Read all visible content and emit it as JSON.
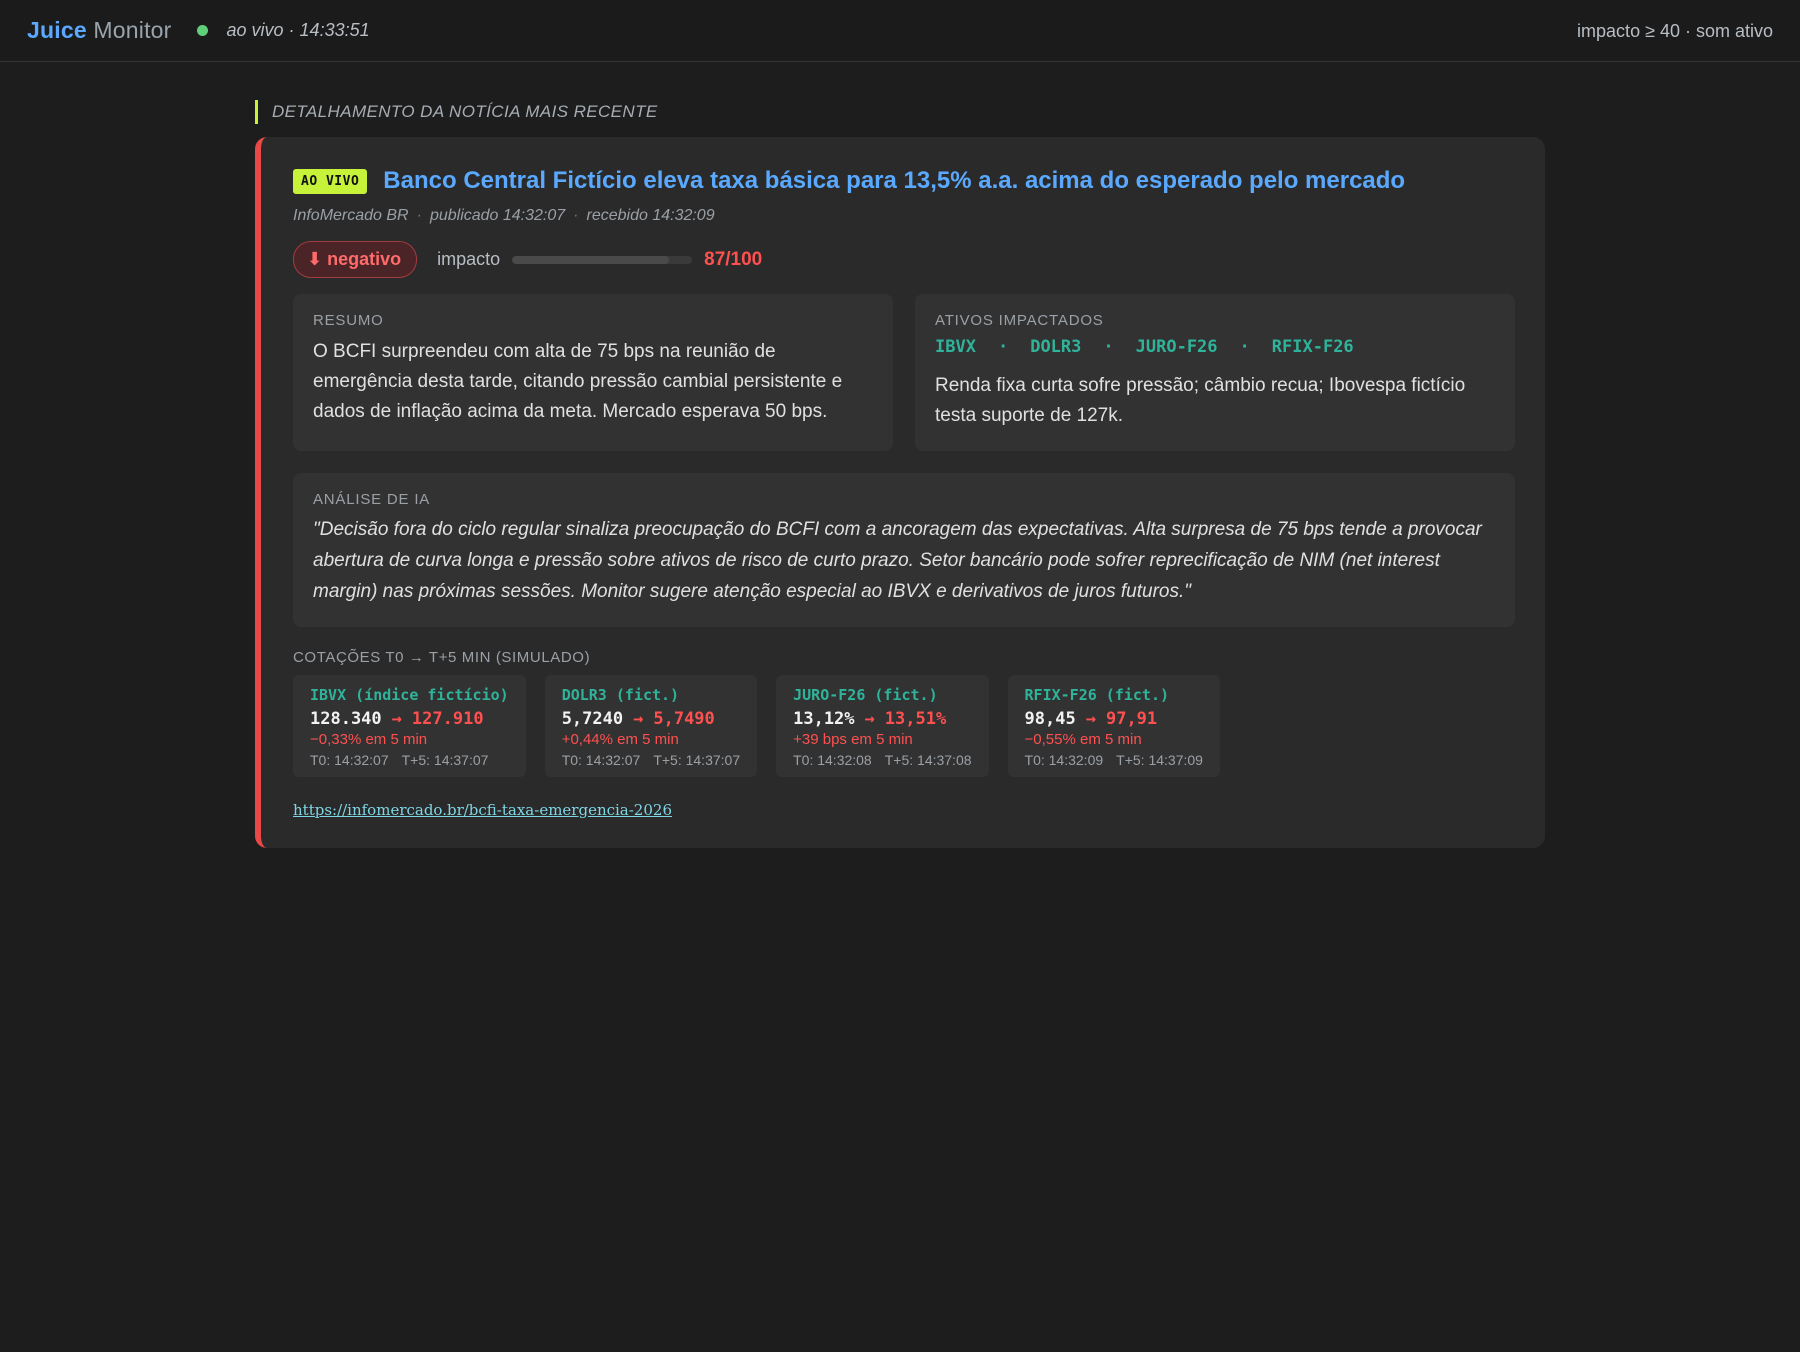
{
  "topbar": {
    "brand_strong": "Juice",
    "brand_rest": " Monitor",
    "live_text": "ao vivo · 14:33:51",
    "right_text": "impacto ≥ 40 · som ativo"
  },
  "section_label": "DETALHAMENTO DA NOTÍCIA MAIS RECENTE",
  "news": {
    "badge": "AO VIVO",
    "headline": "Banco Central Fictício eleva taxa básica para 13,5% a.a. acima do esperado pelo mercado",
    "source": "InfoMercado BR",
    "published": "publicado 14:32:07",
    "received": "recebido 14:32:09",
    "sentiment": "⬇ negativo",
    "impact_label": "impacto",
    "impact_value": "87/100",
    "impact_fraction": 0.87,
    "summary_title": "RESUMO",
    "summary": "O BCFI surpreendeu com alta de 75 bps na reunião de emergência desta tarde, citando pressão cambial persistente e dados de inflação acima da meta. Mercado esperava 50 bps.",
    "assets_title": "ATIVOS IMPACTADOS",
    "assets": [
      "IBVX",
      "DOLR3",
      "JURO-F26",
      "RFIX-F26"
    ],
    "assets_text": "Renda fixa curta sofre pressão; câmbio recua; Ibovespa fictício testa suporte de 127k.",
    "analysis_title": "ANÁLISE DE IA",
    "analysis": "\"Decisão fora do ciclo regular sinaliza preocupação do BCFI com a ancoragem das expectativas. Alta surpresa de 75 bps tende a provocar abertura de curva longa e pressão sobre ativos de risco de curto prazo. Setor bancário pode sofrer reprecificação de NIM (net interest margin) nas próximas sessões. Monitor sugere atenção especial ao IBVX e derivativos de juros futuros.\"",
    "quotes_title": "COTAÇÕES T0 → T+5 MIN (SIMULADO)",
    "quotes": [
      {
        "name": "IBVX (índice fictício)",
        "from": "128.340",
        "to": "127.910",
        "change": "−0,33% em 5 min",
        "t0": "T0: 14:32:07",
        "t5": "T+5: 14:37:07"
      },
      {
        "name": "DOLR3 (fict.)",
        "from": "5,7240",
        "to": "5,7490",
        "change": "+0,44% em 5 min",
        "t0": "T0: 14:32:07",
        "t5": "T+5: 14:37:07"
      },
      {
        "name": "JURO-F26 (fict.)",
        "from": "13,12%",
        "to": "13,51%",
        "change": "+39 bps em 5 min",
        "t0": "T0: 14:32:08",
        "t5": "T+5: 14:37:08"
      },
      {
        "name": "RFIX-F26 (fict.)",
        "from": "98,45",
        "to": "97,91",
        "change": "−0,55% em 5 min",
        "t0": "T0: 14:32:09",
        "t5": "T+5: 14:37:09"
      }
    ],
    "arrow": "→",
    "link": "https://infomercado.br/bcfi-taxa-emergencia-2026"
  },
  "colors": {
    "accent": "#5aa9ff",
    "live": "#c6f23a",
    "negative": "#ff5050",
    "ticker": "#2fb39a",
    "background": "#1d1d1d"
  }
}
